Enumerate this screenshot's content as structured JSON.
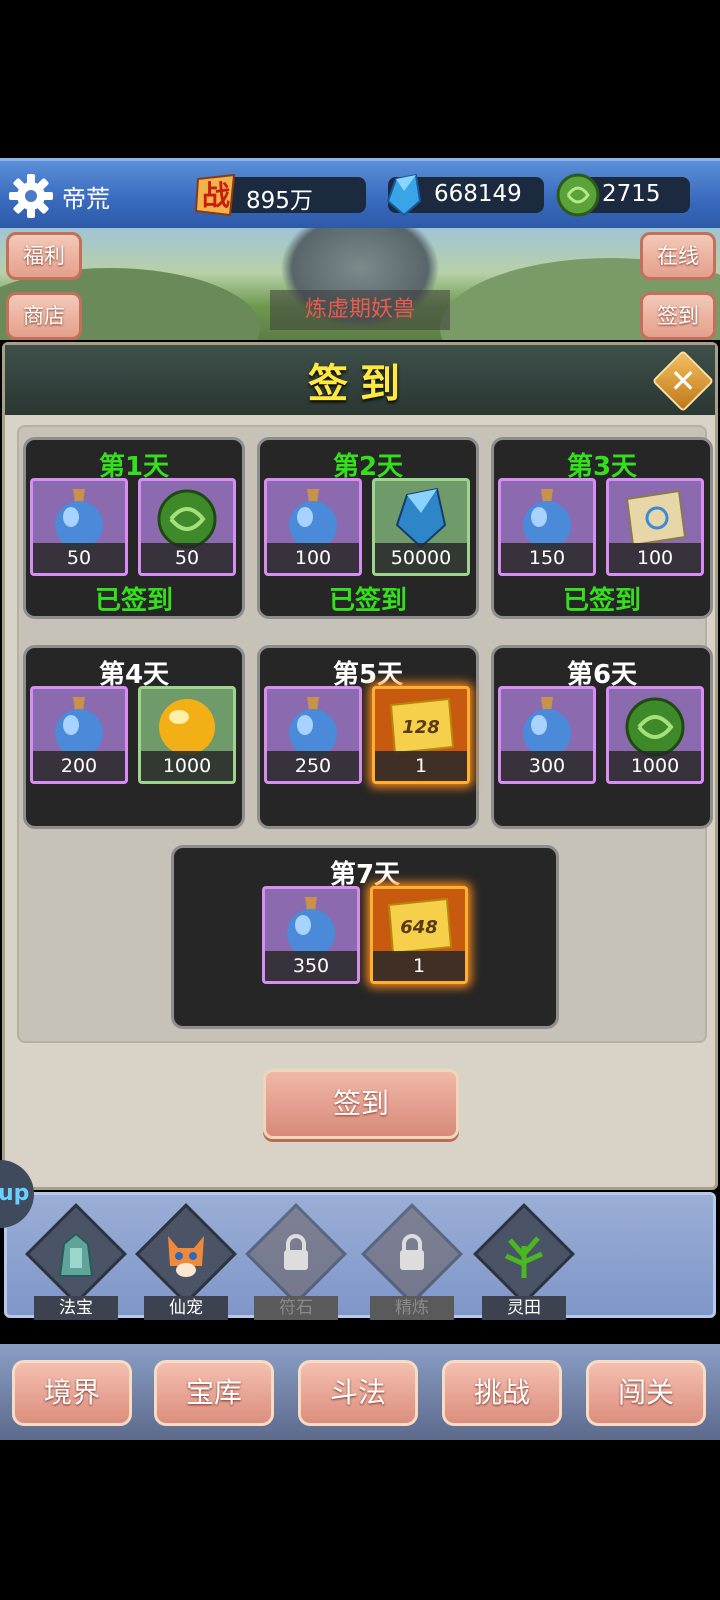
{
  "header": {
    "player_name": "帝荒",
    "power_value": "895万",
    "gems_value": "668149",
    "jade_value": "2715",
    "icons": [
      "gear-icon",
      "battle-icon",
      "crystal-icon",
      "jade-coin-icon"
    ]
  },
  "scene": {
    "left_buttons": [
      "福利",
      "商店"
    ],
    "right_buttons": [
      "在线",
      "签到"
    ],
    "stage_label": "炼虚期妖兽"
  },
  "dialog": {
    "title": "签到",
    "close_icon": "close-icon",
    "days": [
      {
        "title": "第1天",
        "status": "已签到",
        "items": [
          {
            "icon": "potion-icon",
            "count": "50"
          },
          {
            "icon": "jade-coin-icon",
            "count": "50"
          }
        ]
      },
      {
        "title": "第2天",
        "status": "已签到",
        "items": [
          {
            "icon": "potion-icon",
            "count": "100"
          },
          {
            "icon": "crystal-icon",
            "count": "50000"
          }
        ]
      },
      {
        "title": "第3天",
        "status": "已签到",
        "items": [
          {
            "icon": "potion-icon",
            "count": "150"
          },
          {
            "icon": "scroll-icon",
            "count": "100"
          }
        ]
      },
      {
        "title": "第4天",
        "status": "",
        "items": [
          {
            "icon": "potion-icon",
            "count": "200"
          },
          {
            "icon": "gold-orb-icon",
            "count": "1000"
          }
        ]
      },
      {
        "title": "第5天",
        "status": "",
        "items": [
          {
            "icon": "potion-icon",
            "count": "250"
          },
          {
            "icon": "coupon-icon",
            "count": "1",
            "face": "128"
          }
        ]
      },
      {
        "title": "第6天",
        "status": "",
        "items": [
          {
            "icon": "potion-icon",
            "count": "300"
          },
          {
            "icon": "jade-coin-icon",
            "count": "1000"
          }
        ]
      },
      {
        "title": "第7天",
        "status": "",
        "items": [
          {
            "icon": "potion-icon",
            "count": "350"
          },
          {
            "icon": "coupon-icon",
            "count": "1",
            "face": "648"
          }
        ]
      }
    ],
    "sign_button": "签到"
  },
  "functions": {
    "badge": "up",
    "items": [
      {
        "label": "法宝",
        "icon": "treasure-icon",
        "locked": false
      },
      {
        "label": "仙宠",
        "icon": "pet-icon",
        "locked": false
      },
      {
        "label": "符石",
        "icon": "lock-icon",
        "locked": true
      },
      {
        "label": "精炼",
        "icon": "lock-icon",
        "locked": true
      },
      {
        "label": "灵田",
        "icon": "plant-icon",
        "locked": false
      }
    ]
  },
  "tabs": [
    "境界",
    "宝库",
    "斗法",
    "挑战",
    "闯关"
  ]
}
